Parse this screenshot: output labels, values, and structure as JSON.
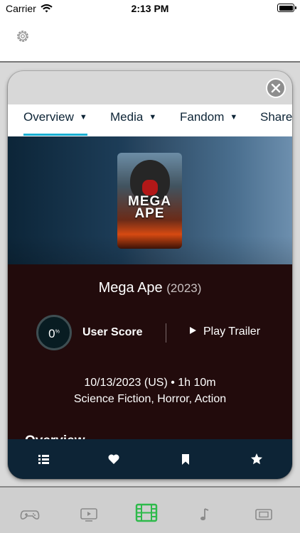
{
  "status_bar": {
    "carrier": "Carrier",
    "time": "2:13 PM"
  },
  "tabs": [
    {
      "label": "Overview",
      "active": true
    },
    {
      "label": "Media"
    },
    {
      "label": "Fandom"
    },
    {
      "label": "Share"
    }
  ],
  "movie": {
    "title": "Mega Ape",
    "year": "(2023)",
    "poster_title_lines": [
      "MEGA",
      "APE"
    ],
    "score": "0",
    "score_unit": "%",
    "score_label": "User Score",
    "play_trailer_label": "Play Trailer",
    "release": "10/13/2023 (US)  •  1h 10m",
    "genres": "Science Fiction, Horror, Action",
    "overview_heading": "Overview"
  },
  "bottom_actions": [
    "list-icon",
    "heart-icon",
    "bookmark-icon",
    "star-icon"
  ],
  "tabbar_items": [
    "gamepad-icon",
    "tv-icon",
    "film-icon",
    "music-icon",
    "ticket-icon"
  ],
  "colors": {
    "accent": "#1ab0d3",
    "active_tab_icon": "#2eba4b",
    "dark_navy": "#0d2436",
    "info_bg": "#220b0c"
  }
}
